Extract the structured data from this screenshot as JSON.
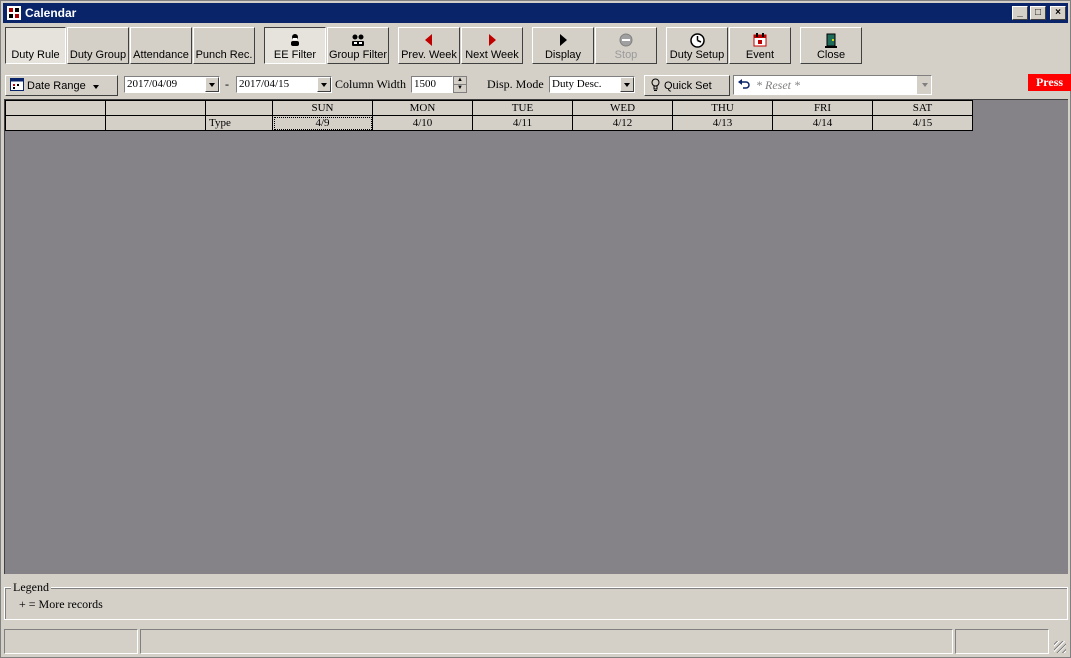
{
  "window": {
    "title": "Calendar",
    "controls": {
      "minimize": "_",
      "maximize": "□",
      "close": "×"
    }
  },
  "toolbar": {
    "buttons": [
      {
        "label": "Duty Rule",
        "icon": "none",
        "state": "pressed"
      },
      {
        "label": "Duty Group",
        "icon": "none",
        "state": "normal"
      },
      {
        "label": "Attendance",
        "icon": "none",
        "state": "normal"
      },
      {
        "label": "Punch Rec.",
        "icon": "none",
        "state": "normal"
      },
      {
        "label": "EE Filter",
        "icon": "person-filter-icon",
        "state": "pressed"
      },
      {
        "label": "Group Filter",
        "icon": "group-filter-icon",
        "state": "normal"
      },
      {
        "label": "Prev. Week",
        "icon": "arrow-left-icon",
        "state": "normal"
      },
      {
        "label": "Next Week",
        "icon": "arrow-right-icon",
        "state": "normal"
      },
      {
        "label": "Display",
        "icon": "play-icon",
        "state": "normal"
      },
      {
        "label": "Stop",
        "icon": "stop-icon",
        "state": "disabled"
      },
      {
        "label": "Duty Setup",
        "icon": "clock-icon",
        "state": "normal"
      },
      {
        "label": "Event",
        "icon": "calendar-event-icon",
        "state": "normal"
      },
      {
        "label": "Close",
        "icon": "door-exit-icon",
        "state": "normal"
      }
    ]
  },
  "filters": {
    "date_range_label": "Date Range",
    "date_from": "2017/04/09",
    "date_sep": "-",
    "date_to": "2017/04/15",
    "column_width_label": "Column Width",
    "column_width": "1500",
    "disp_mode_label": "Disp. Mode",
    "disp_mode": "Duty Desc.",
    "quick_set_label": "Quick Set",
    "reset_value": "* Reset *",
    "press_badge": "Press"
  },
  "grid": {
    "day_headers": [
      "SUN",
      "MON",
      "TUE",
      "WED",
      "THU",
      "FRI",
      "SAT"
    ],
    "dates": [
      "4/9",
      "4/10",
      "4/11",
      "4/12",
      "4/13",
      "4/14",
      "4/15"
    ],
    "type_label": "Type"
  },
  "legend": {
    "title": "Legend",
    "items": [
      "+ = More records"
    ]
  },
  "colors": {
    "titlebar": "#0a246a",
    "grid_background": "#858387",
    "press_badge": "#ff0000"
  }
}
